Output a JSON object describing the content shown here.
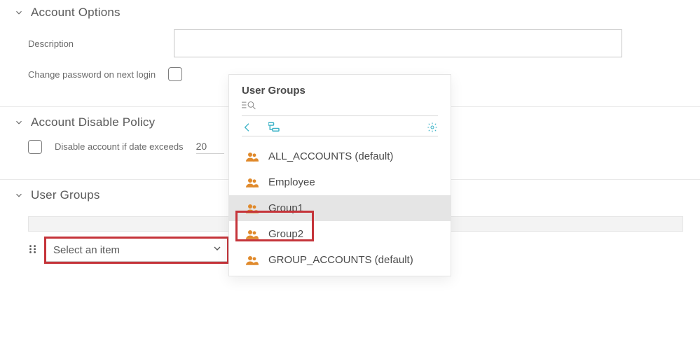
{
  "account_options": {
    "title": "Account Options",
    "description_label": "Description",
    "description_value": "",
    "change_pw_label": "Change password on next login"
  },
  "disable_policy": {
    "title": "Account Disable Policy",
    "checkbox_label": "Disable account if date exceeds",
    "date_value": "20"
  },
  "user_groups": {
    "title": "User Groups",
    "select_placeholder": "Select an item"
  },
  "popup": {
    "title": "User Groups",
    "items": [
      {
        "label": "ALL_ACCOUNTS (default)"
      },
      {
        "label": "Employee"
      },
      {
        "label": "Group1"
      },
      {
        "label": "Group2"
      },
      {
        "label": "GROUP_ACCOUNTS (default)"
      }
    ]
  }
}
